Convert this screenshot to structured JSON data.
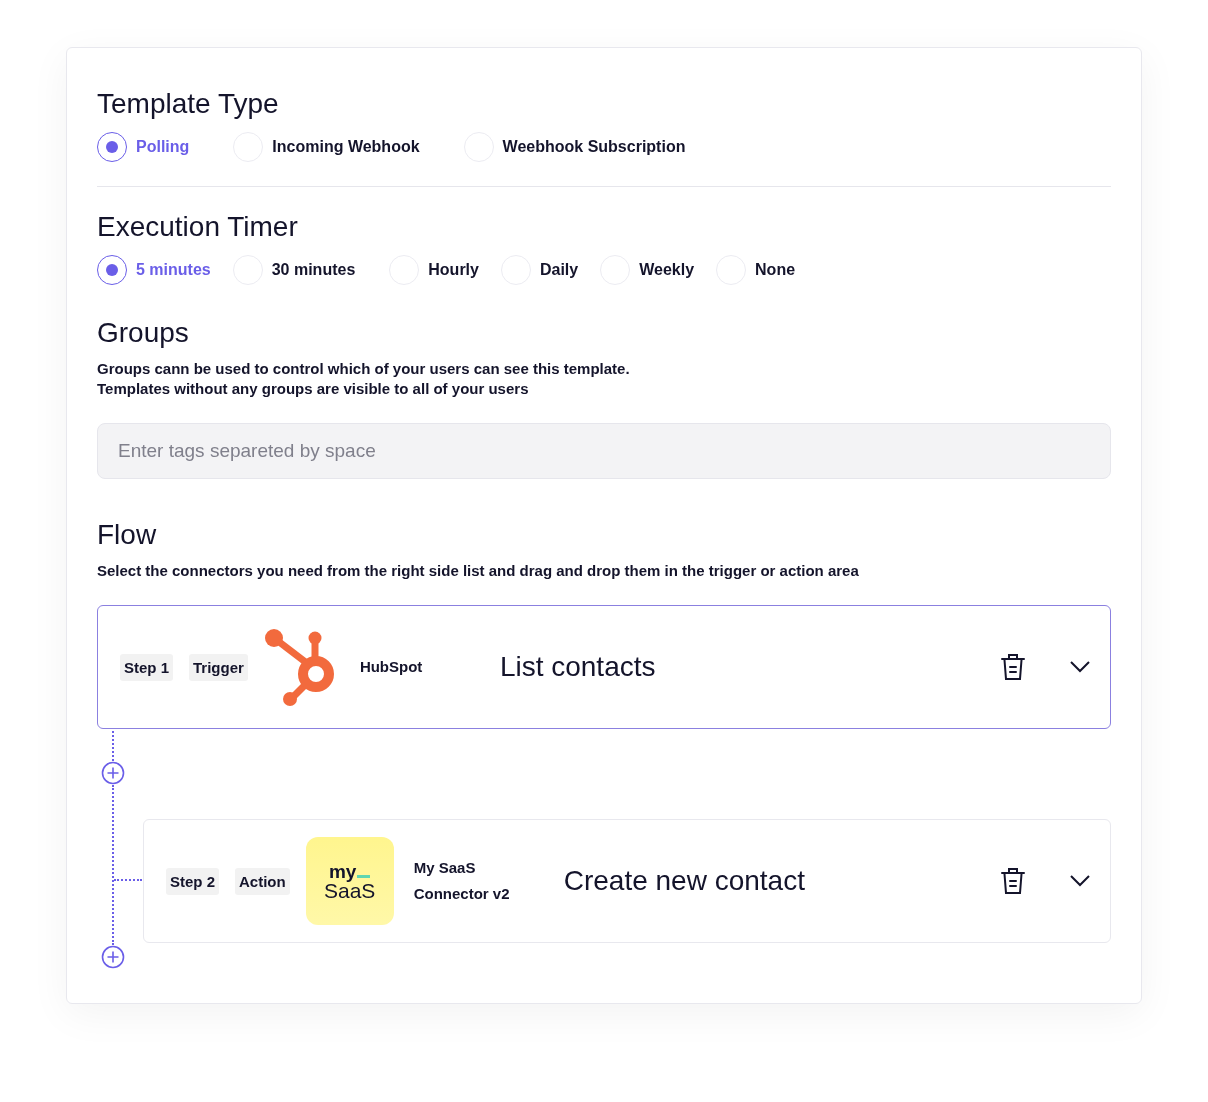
{
  "template_type": {
    "title": "Template Type",
    "options": [
      {
        "label": "Polling",
        "selected": true
      },
      {
        "label": "Incoming Webhook",
        "selected": false
      },
      {
        "label": "Weebhook Subscription",
        "selected": false
      }
    ]
  },
  "execution_timer": {
    "title": "Execution Timer",
    "options": [
      {
        "label": "5 minutes",
        "selected": true
      },
      {
        "label": "30 minutes",
        "selected": false
      },
      {
        "label": "Hourly",
        "selected": false
      },
      {
        "label": "Daily",
        "selected": false
      },
      {
        "label": "Weekly",
        "selected": false
      },
      {
        "label": "None",
        "selected": false
      }
    ]
  },
  "groups": {
    "title": "Groups",
    "description": [
      "Groups cann be used to control which of your users can see this template.",
      "Templates without any groups are visible to all of your users"
    ],
    "placeholder": "Enter tags separeted by space"
  },
  "flow": {
    "title": "Flow",
    "description": "Select the connectors you need from the right side list and drag  and drop them  in the trigger or action area",
    "steps": [
      {
        "step": "Step 1",
        "kind": "trigger",
        "role": "Trigger",
        "selected": true,
        "logo": {
          "kind": "hubspot"
        },
        "connector": [
          "HubSpot"
        ],
        "operation": "List contacts"
      },
      {
        "step": "Step 2",
        "kind": "action",
        "role": "Action",
        "selected": false,
        "logo": {
          "kind": "text",
          "text": [
            "my",
            "SaaS"
          ]
        },
        "connector": [
          "My SaaS",
          "Connector v2"
        ],
        "operation": "Create new contact"
      }
    ]
  }
}
